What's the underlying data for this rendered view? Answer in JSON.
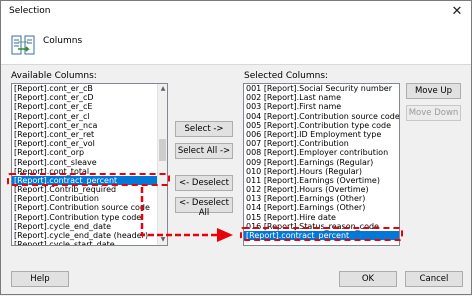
{
  "window": {
    "title": "Selection",
    "close_glyph": "✕"
  },
  "header": {
    "label": "Columns",
    "icon": "columns-icon"
  },
  "available": {
    "label": "Available Columns:",
    "items": [
      "[Report].cont_er_cB",
      "[Report].cont_er_cD",
      "[Report].cont_er_cE",
      "[Report].cont_er_cl",
      "[Report].cont_er_nca",
      "[Report].cont_er_ret",
      "[Report].cont_er_vol",
      "[Report].cont_orp",
      "[Report].cont_sleave",
      "[Report].cont_total",
      "[Report].contract_percent",
      "[Report].Contrib_required",
      "[Report].Contribution",
      "[Report].Contribution source code",
      "[Report].Contribution type code",
      "[Report].cycle_end_date",
      "[Report].cycle_end_date (header)",
      "[Report].cycle_start_date"
    ],
    "selected_index": 10
  },
  "selected": {
    "label": "Selected Columns:",
    "items": [
      "001 [Report].Social Security number",
      "002 [Report].Last name",
      "003 [Report].First name",
      "004 [Report].Contribution source code",
      "005 [Report].Contribution type code",
      "006 [Report].ID Employment type",
      "007 [Report].Contribution",
      "008 [Report].Employer contribution",
      "009 [Report].Earnings (Regular)",
      "010 [Report].Hours (Regular)",
      "011 [Report].Earnings (Overtime)",
      "012 [Report].Hours (Overtime)",
      "013 [Report].Earnings (Other)",
      "014 [Report].Earnings (Other)",
      "015 [Report].Hire date",
      "016 [Report].Status_reason_code",
      "[Report].contract_percent"
    ],
    "selected_index": 16
  },
  "buttons": {
    "select": "Select ->",
    "select_all": "Select All ->",
    "deselect": "<- Deselect",
    "deselect_all": "<- Deselect All",
    "move_up": "Move Up",
    "move_down": "Move Down",
    "help": "Help",
    "ok": "OK",
    "cancel": "Cancel"
  },
  "colors": {
    "highlight": "#0078d7",
    "annotation": "#e8000b"
  }
}
